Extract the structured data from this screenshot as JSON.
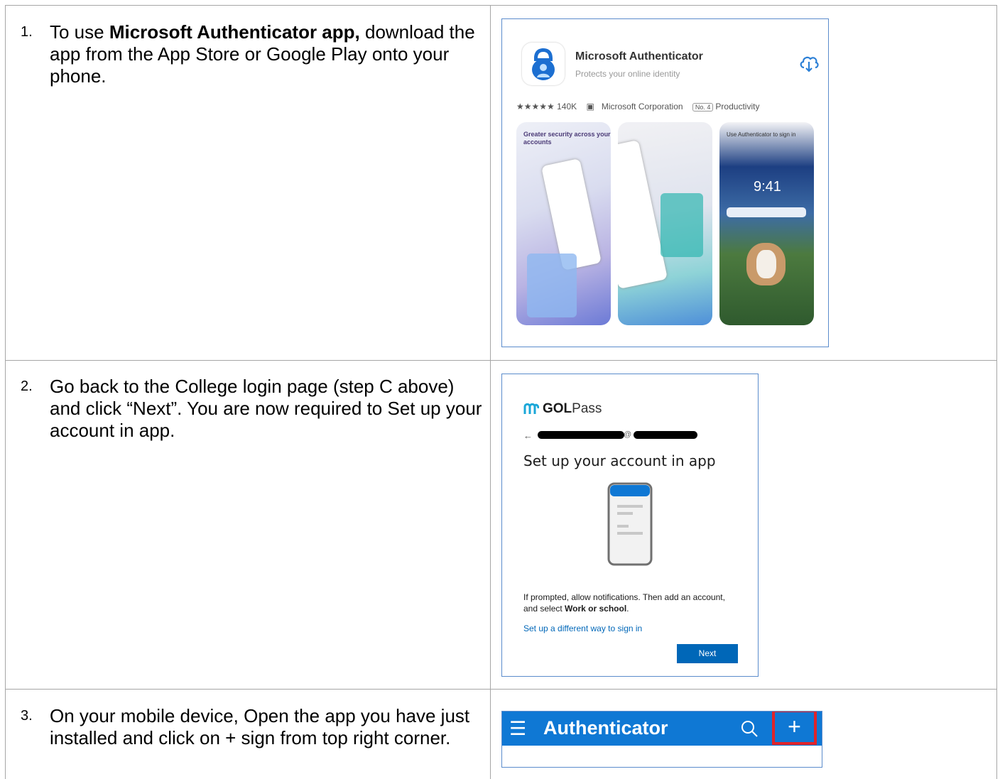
{
  "steps": [
    {
      "number": "1.",
      "pre": "To use ",
      "bold": "Microsoft Authenticator app,",
      "post": " download the app from the App Store or Google Play onto your phone."
    },
    {
      "number": "2.",
      "text": "Go back to the College login page (step C above) and click “Next”. You are now required to Set up your account in app."
    },
    {
      "number": "3.",
      "text": "On your mobile device, Open the app you have just installed and click on + sign from top right corner."
    }
  ],
  "store_card": {
    "app_name": "Microsoft Authenticator",
    "app_subtitle": "Protects your online identity",
    "rating": "★★★★★ 140K",
    "developer": "Microsoft Corporation",
    "rank": "No. 4",
    "category": "Productivity",
    "screenshot1_caption": "Greater security across your accounts",
    "screenshot3_caption": "Use Authenticator to sign in",
    "lock_time": "9:41",
    "colors": {
      "icon_blue": "#1c6fd1",
      "download_icon": "#2b7fd6"
    }
  },
  "golpass": {
    "logo_bold": "GOL",
    "logo_light": "Pass",
    "at_sign": "@",
    "heading": "Set up your account in app",
    "notice_pre": "If prompted, allow notifications. Then add an account, and select ",
    "notice_bold": "Work or school",
    "notice_post": ".",
    "alt_link": "Set up a different way to sign in",
    "next_label": "Next",
    "colors": {
      "accent": "#0067b8"
    }
  },
  "authenticator_bar": {
    "title": "Authenticator",
    "plus": "+",
    "colors": {
      "bar": "#0f78d4",
      "highlight": "#e0242a"
    }
  }
}
